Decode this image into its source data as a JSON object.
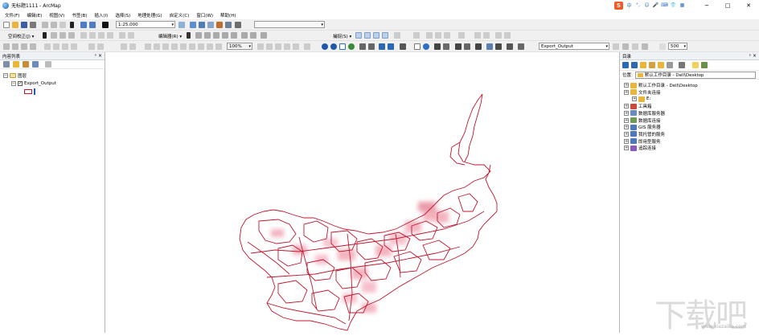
{
  "window": {
    "title": "无标题1111 - ArcMap",
    "controls": {
      "minimize": "─",
      "maximize": "□",
      "close": "✕"
    }
  },
  "ime": {
    "logo": "S",
    "items": [
      "中",
      "°,",
      "☺",
      "🎤",
      "⌨",
      "👕",
      "▦"
    ]
  },
  "menu": [
    "文件(F)",
    "编辑(E)",
    "视图(V)",
    "书签(B)",
    "插入(I)",
    "选择(S)",
    "地理处理(G)",
    "自定义(C)",
    "窗口(W)",
    "帮助(H)"
  ],
  "toolbar": {
    "scale_value": "1:25,000",
    "blank_dropdown": "",
    "spatial_adjust_label": "空间校正(J) ▾",
    "editor_label": "编辑器(R) ▾",
    "snapping_label": "捕捉(S) ▾",
    "percent_value": "100%",
    "layer_dropdown": "Export_Output",
    "size_value": "500"
  },
  "toc": {
    "title": "内容列表",
    "pin": "ᵖ",
    "close": "×",
    "group": "图层",
    "layer": "Export_Output"
  },
  "catalog": {
    "title": "目录",
    "pin": "ᵖ",
    "close": "×",
    "location_label": "位置:",
    "location_value": "默认工作目录 - Dell\\Desktop",
    "items": [
      {
        "label": "默认工作目录 - Dell\\Desktop",
        "icon": "home-folder-icon",
        "color": "#e9b63b",
        "level": 0
      },
      {
        "label": "文件夹连接",
        "icon": "folder-connection-icon",
        "color": "#e9b63b",
        "level": 0
      },
      {
        "label": "E:",
        "icon": "drive-folder-icon",
        "color": "#e9b63b",
        "level": 1
      },
      {
        "label": "工具箱",
        "icon": "toolbox-icon",
        "color": "#c94a3a",
        "level": 0
      },
      {
        "label": "数据库服务器",
        "icon": "database-server-icon",
        "color": "#6a8bbd",
        "level": 0
      },
      {
        "label": "数据库连接",
        "icon": "database-connection-icon",
        "color": "#6f9b54",
        "level": 0
      },
      {
        "label": "GIS 服务器",
        "icon": "gis-server-icon",
        "color": "#4d79b8",
        "level": 0
      },
      {
        "label": "我托管的服务",
        "icon": "hosted-services-icon",
        "color": "#4d79b8",
        "level": 0
      },
      {
        "label": "即用型服务",
        "icon": "ready-services-icon",
        "color": "#4d79b8",
        "level": 0
      },
      {
        "label": "追踪连接",
        "icon": "tracking-connection-icon",
        "color": "#8a5ab8",
        "level": 0
      }
    ]
  },
  "colors": {
    "feature_outline": "#c0172f",
    "feature_fill": "#e9748a"
  },
  "watermark": {
    "text": "下载吧",
    "url": "www.xiazaiba.com"
  }
}
